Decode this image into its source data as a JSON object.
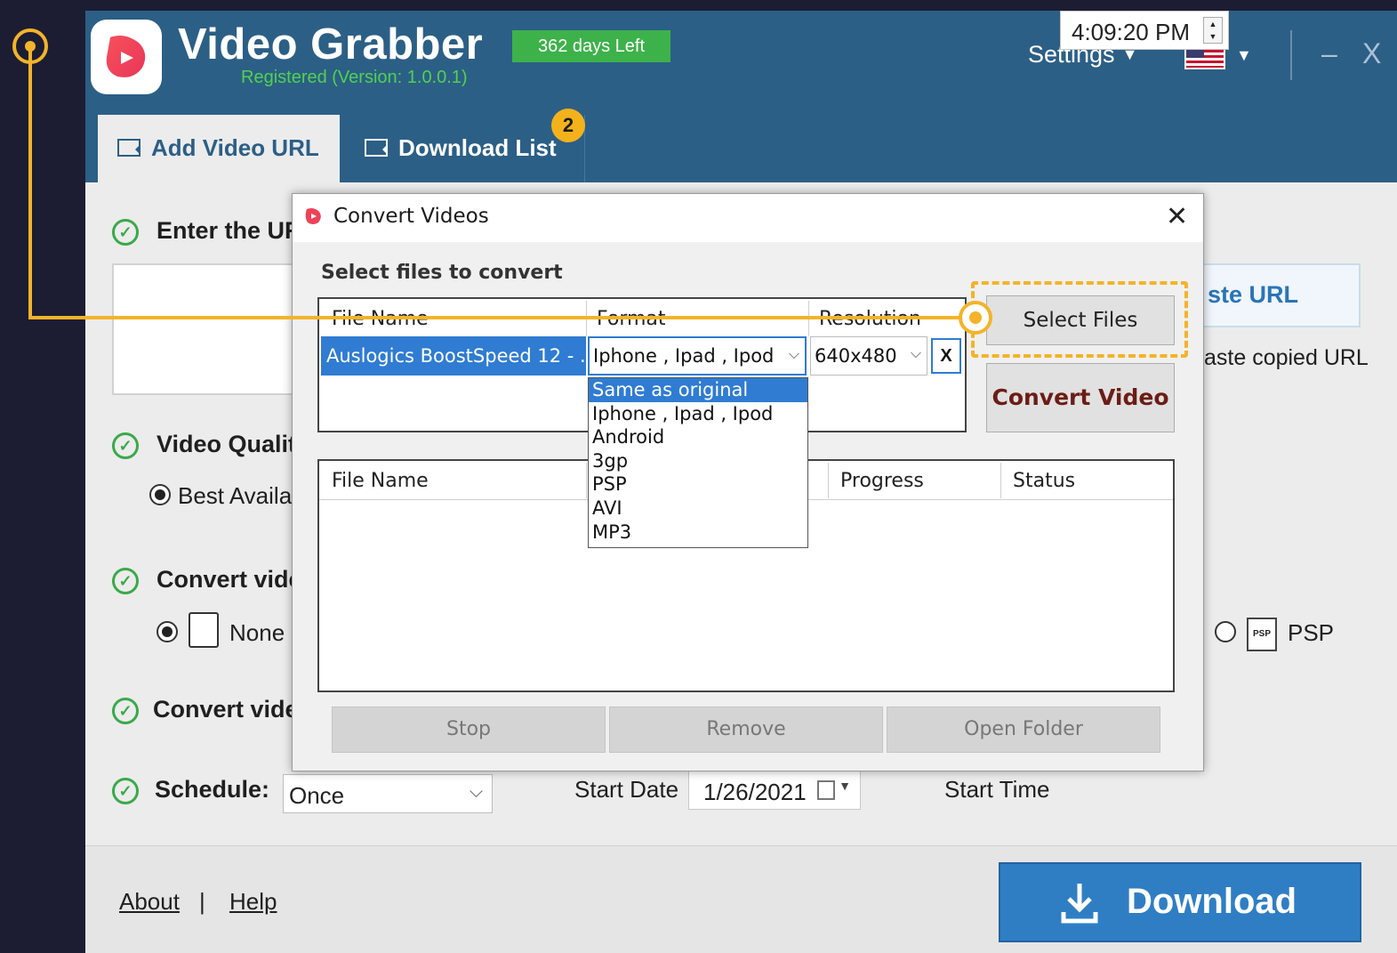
{
  "app": {
    "title": "Video Grabber",
    "registration": "Registered (Version: 1.0.0.1)",
    "days_left": "362 days Left",
    "settings_label": "Settings",
    "flag": "us-flag-icon",
    "minimize": "–",
    "close": "X"
  },
  "tabs": [
    {
      "label": "Add Video URL",
      "active": true
    },
    {
      "label": "Download List",
      "active": false,
      "badge": "2"
    }
  ],
  "main": {
    "enter_url_label": "Enter the UR",
    "paste_url_button": "ste URL",
    "paste_hint": "aste copied URL",
    "video_quality_label": "Video Qualit",
    "quality_option": "Best Availal",
    "convert_video_label_1": "Convert vide",
    "convert_none_option": "None",
    "convert_psp_option": "PSP",
    "convert_video_label_2": "Convert vide",
    "schedule_label": "Schedule:",
    "schedule_value": "Once",
    "start_date_label": "Start Date",
    "start_date_value": "1/26/2021",
    "start_time_label": "Start Time",
    "start_time_value": "4:09:20 PM"
  },
  "footer": {
    "about": "About",
    "separator": "|",
    "help": "Help",
    "download_button": "Download"
  },
  "dialog": {
    "title": "Convert Videos",
    "close": "X",
    "heading": "Select files to convert",
    "columns": [
      "File Name",
      "Format",
      "Resolution"
    ],
    "file_row": {
      "name": "Auslogics BoostSpeed 12 - ...",
      "format": "Iphone , Ipad , Ipod",
      "resolution": "640x480",
      "delete": "X"
    },
    "format_options": [
      "Same as original",
      "Iphone , Ipad , Ipod",
      "Android",
      "3gp",
      "PSP",
      "AVI",
      "MP3"
    ],
    "format_selected_index": 0,
    "select_files_button": "Select Files",
    "convert_button": "Convert Video",
    "progress_columns": [
      "File Name",
      "Progress",
      "Status"
    ],
    "buttons": {
      "stop": "Stop",
      "remove": "Remove",
      "open_folder": "Open Folder"
    }
  },
  "colors": {
    "titlebar": "#2c5f86",
    "accent_green": "#3db24a",
    "badge_yellow": "#f3b21b",
    "callout": "#f4b32a",
    "selection_blue": "#2f7cd2",
    "download_blue": "#2f7ec4"
  }
}
